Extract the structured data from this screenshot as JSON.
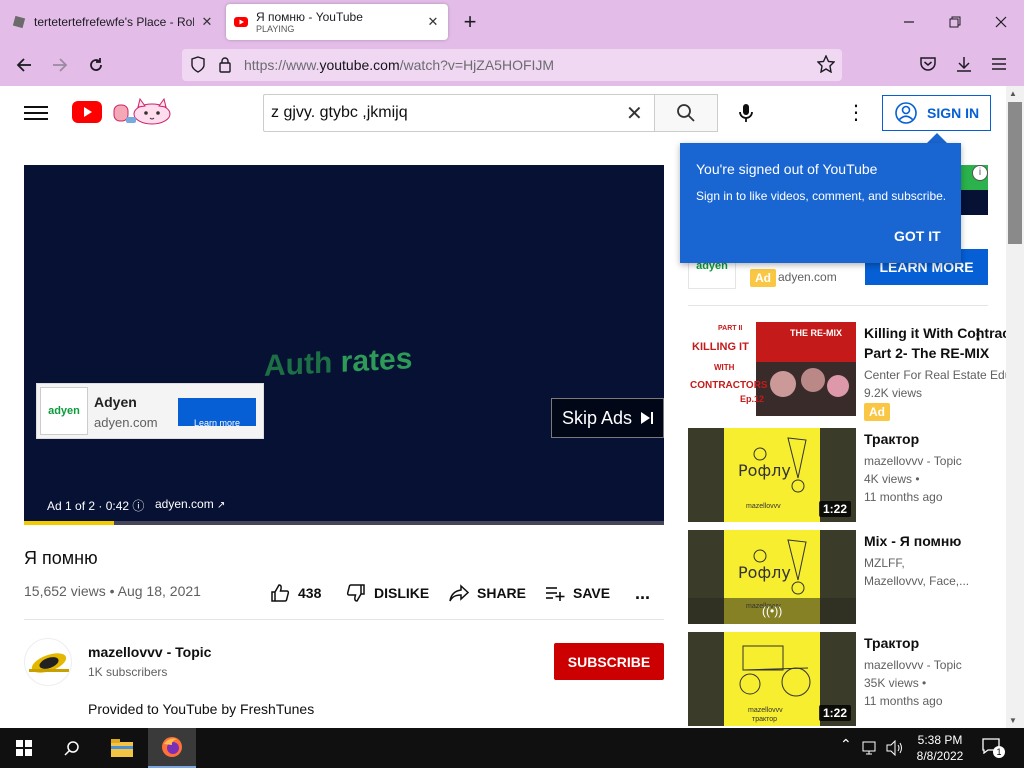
{
  "browser": {
    "tabs": [
      {
        "title": "tertetertefrefewfe's Place - Robl",
        "subtitle": "",
        "active": false
      },
      {
        "title": "Я помню - YouTube",
        "subtitle": "PLAYING",
        "active": true
      }
    ],
    "url_prefix": "https://www.",
    "url_domain": "youtube.com",
    "url_path": "/watch?v=HjZA5HOFIJM"
  },
  "youtube": {
    "search_query": "z gjvy. gtybc ,jkmijq",
    "sign_in_label": "SIGN IN",
    "tooltip": {
      "title": "You're signed out of YouTube",
      "body": "Sign in to like videos, comment, and subscribe.",
      "button": "GOT IT"
    },
    "player": {
      "ad_text_1": "Auth",
      "ad_text_2": "rates",
      "ad_card_logo": "adyen",
      "ad_card_name": "Adyen",
      "ad_card_domain": "adyen.com",
      "ad_card_button": "Learn more",
      "skip_label": "Skip Ads",
      "ad_info": "Ad 1 of 2 · 0:42",
      "ad_domain": "adyen.com",
      "progress": 0.14
    },
    "video": {
      "title": "Я помню",
      "meta": "15,652 views • Aug 18, 2021",
      "like_count": "438",
      "dislike_label": "DISLIKE",
      "share_label": "SHARE",
      "save_label": "SAVE",
      "more_label": "..."
    },
    "channel": {
      "name": "mazellovvv - Topic",
      "subs": "1K subscribers",
      "subscribe_label": "SUBSCRIBE",
      "description": "Provided to YouTube by FreshTunes"
    },
    "side_ad": {
      "logo": "adyen",
      "badge": "Ad",
      "domain": "adyen.com",
      "button": "LEARN MORE"
    },
    "related": [
      {
        "title": "Killing it With Contracto",
        "title2": "Part 2- The RE-MIX",
        "channel": "Center For Real Estate Edu",
        "views": "9.2K views",
        "age": "",
        "duration": "",
        "badge": "Ad",
        "thumb_text1": "PART II",
        "thumb_text2": "KILLING IT WITH CONTRACTORS",
        "thumb_text3": "THE RE-MIX",
        "thumb_text4": "Ep.12"
      },
      {
        "title": "Трактор",
        "title2": "",
        "channel": "mazellovvv - Topic",
        "views": "4K views •",
        "age": "11 months ago",
        "duration": "1:22",
        "badge": "",
        "thumb_text1": "Рофлу",
        "thumb_text2": "mazellovvv"
      },
      {
        "title": "Mix - Я помню",
        "title2": "",
        "channel": "MZLFF,",
        "views": "Mazellovvv, Face,...",
        "age": "",
        "duration": "",
        "badge": "",
        "thumb_text1": "Рофлу",
        "thumb_text2": "mazellovvv"
      },
      {
        "title": "Трактор",
        "title2": "",
        "channel": "mazellovvv - Topic",
        "views": "35K views •",
        "age": "11 months ago",
        "duration": "1:22",
        "badge": "",
        "thumb_text1": "mazellovvv",
        "thumb_text2": "трактор"
      }
    ]
  },
  "taskbar": {
    "time": "5:38 PM",
    "date": "8/8/2022",
    "notification_count": "1"
  },
  "colors": {
    "browser_chrome": "#e3bde8",
    "yt_red": "#ff0000",
    "link_blue": "#065fd4",
    "tooltip_blue": "#1966d2",
    "player_bg": "#061134",
    "ad_yellow": "#f9c743",
    "subscribe_red": "#cc0000"
  }
}
